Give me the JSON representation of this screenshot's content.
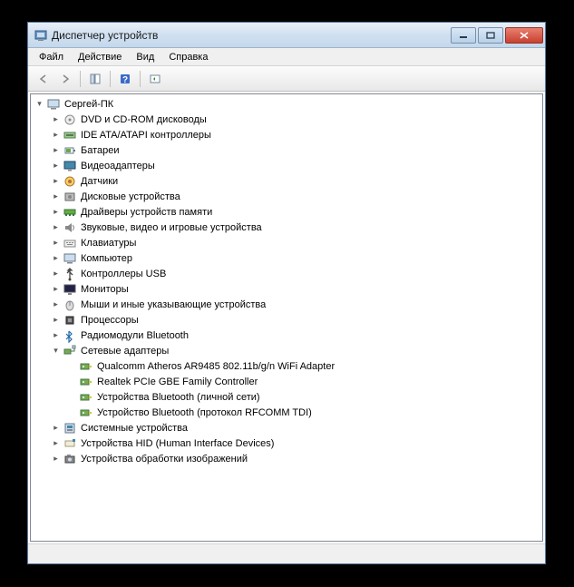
{
  "window": {
    "title": "Диспетчер устройств"
  },
  "menu": {
    "file": "Файл",
    "action": "Действие",
    "view": "Вид",
    "help": "Справка"
  },
  "root": {
    "label": "Сергей-ПК",
    "icon": "computer"
  },
  "categories": [
    {
      "label": "DVD и CD-ROM дисководы",
      "icon": "disc",
      "expanded": false
    },
    {
      "label": "IDE ATA/ATAPI контроллеры",
      "icon": "ide",
      "expanded": false
    },
    {
      "label": "Батареи",
      "icon": "battery",
      "expanded": false
    },
    {
      "label": "Видеоадаптеры",
      "icon": "display",
      "expanded": false
    },
    {
      "label": "Датчики",
      "icon": "sensor",
      "expanded": false
    },
    {
      "label": "Дисковые устройства",
      "icon": "disk",
      "expanded": false
    },
    {
      "label": "Драйверы устройств памяти",
      "icon": "memory",
      "expanded": false
    },
    {
      "label": "Звуковые, видео и игровые устройства",
      "icon": "sound",
      "expanded": false
    },
    {
      "label": "Клавиатуры",
      "icon": "keyboard",
      "expanded": false
    },
    {
      "label": "Компьютер",
      "icon": "computer",
      "expanded": false
    },
    {
      "label": "Контроллеры USB",
      "icon": "usb",
      "expanded": false
    },
    {
      "label": "Мониторы",
      "icon": "monitor",
      "expanded": false
    },
    {
      "label": "Мыши и иные указывающие устройства",
      "icon": "mouse",
      "expanded": false
    },
    {
      "label": "Процессоры",
      "icon": "cpu",
      "expanded": false
    },
    {
      "label": "Радиомодули Bluetooth",
      "icon": "bluetooth",
      "expanded": false
    },
    {
      "label": "Сетевые адаптеры",
      "icon": "network",
      "expanded": true,
      "children": [
        {
          "label": "Qualcomm Atheros AR9485 802.11b/g/n WiFi Adapter",
          "icon": "netcard"
        },
        {
          "label": "Realtek PCIe GBE Family Controller",
          "icon": "netcard"
        },
        {
          "label": "Устройства Bluetooth (личной сети)",
          "icon": "netcard"
        },
        {
          "label": "Устройство Bluetooth (протокол RFCOMM TDI)",
          "icon": "netcard"
        }
      ]
    },
    {
      "label": "Системные устройства",
      "icon": "system",
      "expanded": false
    },
    {
      "label": "Устройства HID (Human Interface Devices)",
      "icon": "hid",
      "expanded": false
    },
    {
      "label": "Устройства обработки изображений",
      "icon": "imaging",
      "expanded": false
    }
  ]
}
